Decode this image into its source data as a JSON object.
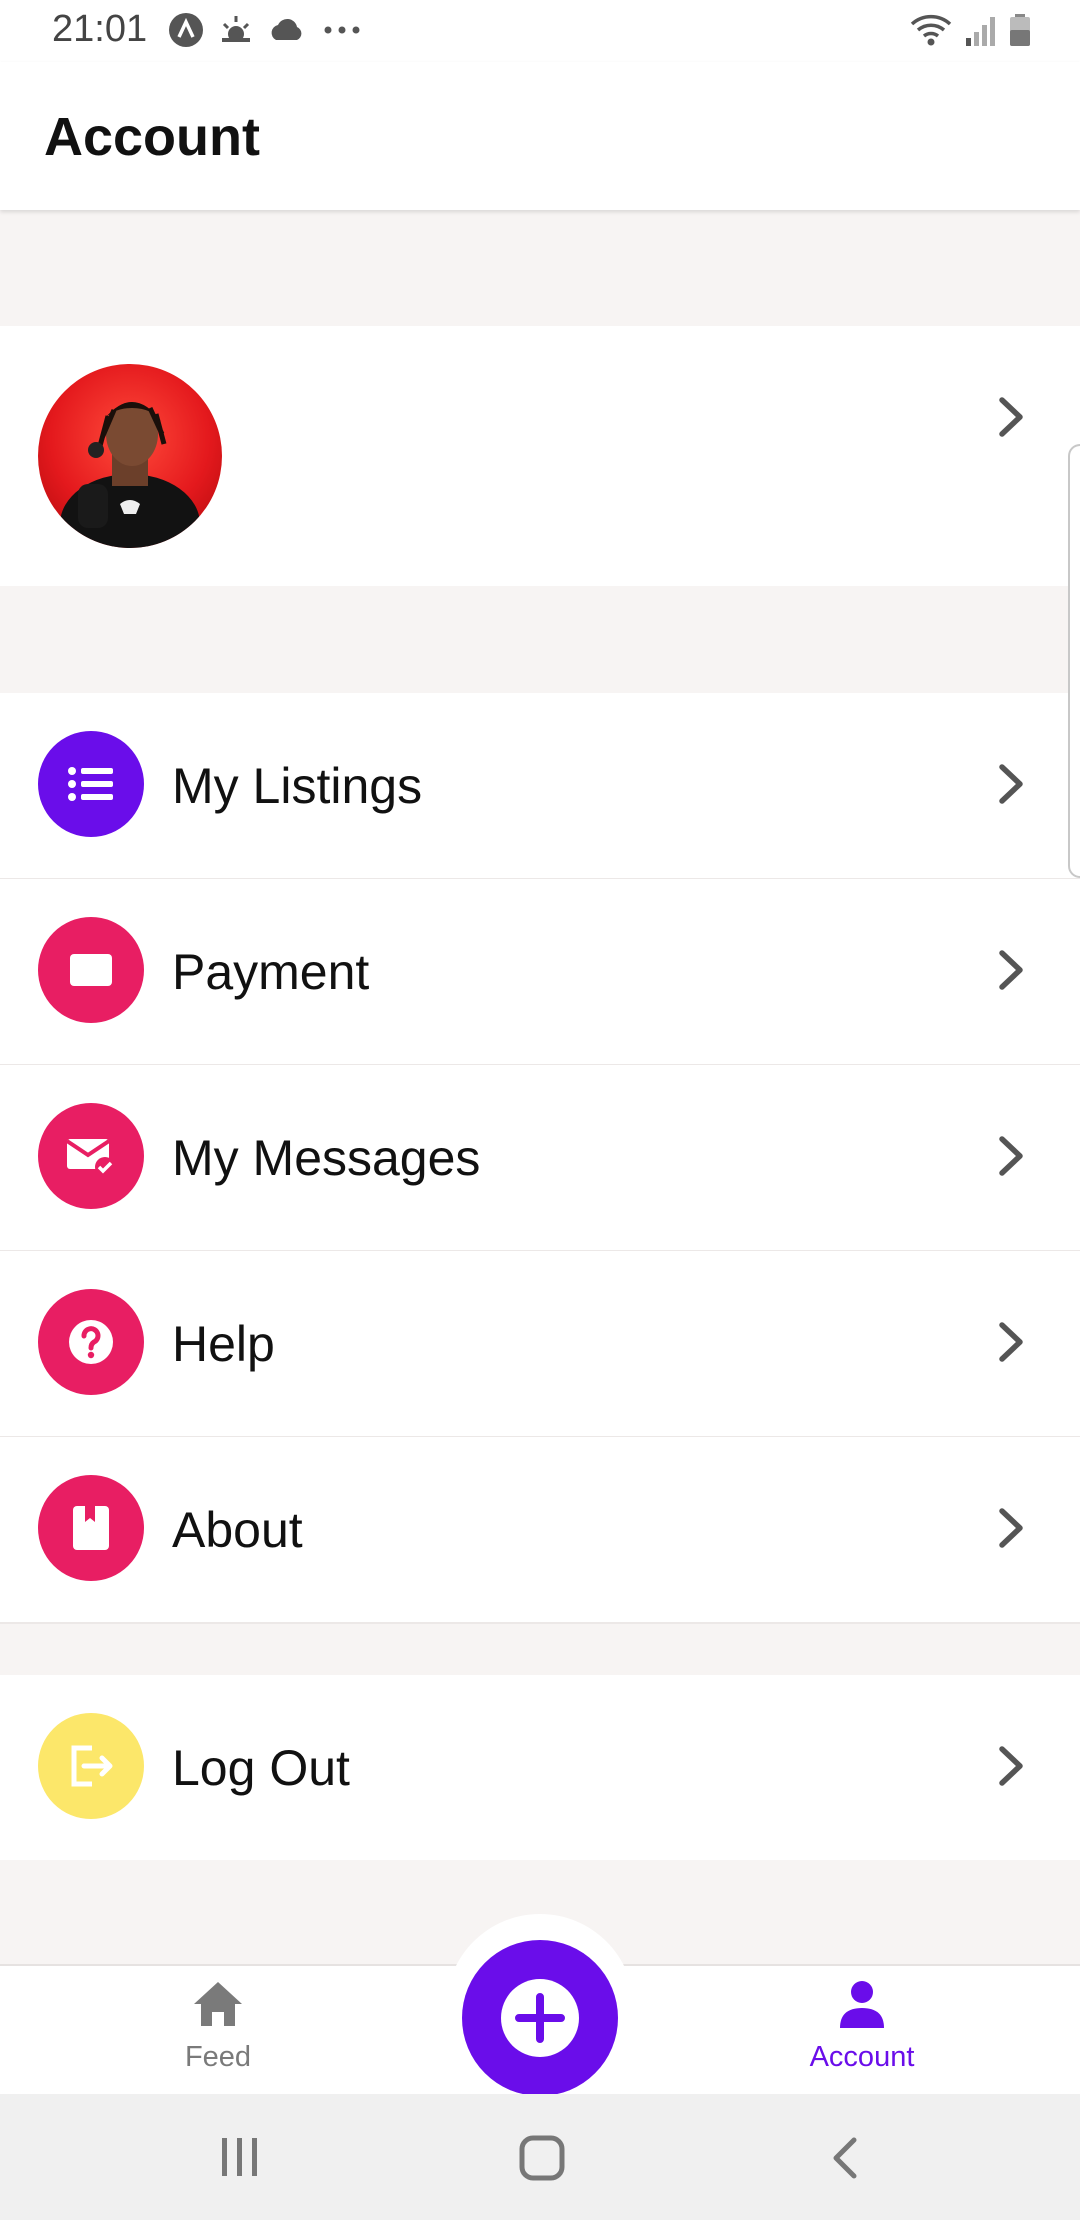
{
  "status_bar": {
    "time": "21:01"
  },
  "header": {
    "title": "Account"
  },
  "profile": {
    "avatar_alt": "profile photo"
  },
  "menu": [
    {
      "label": "My Listings",
      "icon": "list-icon",
      "color": "#6a0dea"
    },
    {
      "label": "Payment",
      "icon": "card-icon",
      "color": "#e81e63"
    },
    {
      "label": "My Messages",
      "icon": "mail-check-icon",
      "color": "#e81e63"
    },
    {
      "label": "Help",
      "icon": "help-icon",
      "color": "#e81e63"
    },
    {
      "label": "About",
      "icon": "book-icon",
      "color": "#e81e63"
    }
  ],
  "logout": {
    "label": "Log Out",
    "icon": "logout-icon",
    "color": "#fce76a"
  },
  "tabs": {
    "feed": "Feed",
    "account": "Account"
  },
  "colors": {
    "accent": "#6a0dea",
    "pink": "#e81e63",
    "yellow": "#fce76a",
    "inactive_tab": "#7a7a7a"
  }
}
